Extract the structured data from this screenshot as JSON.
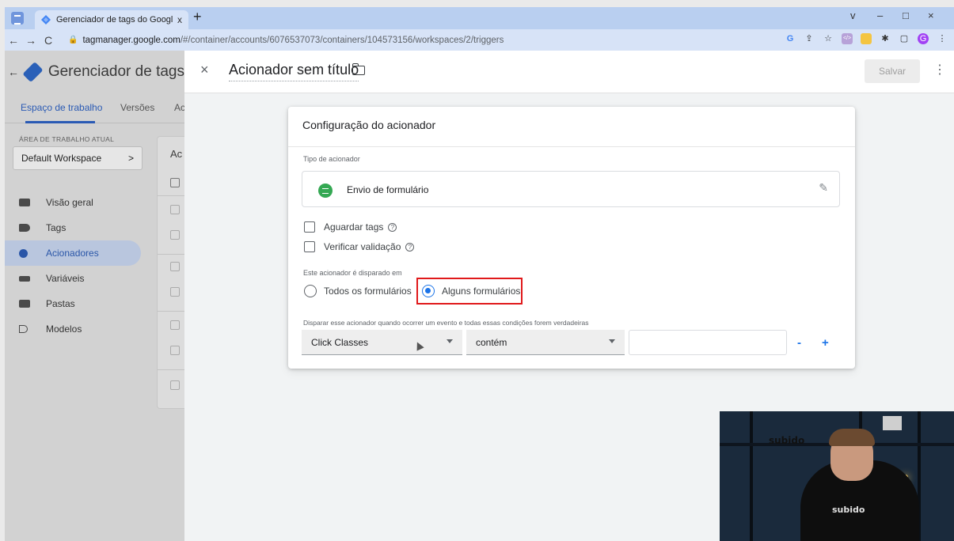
{
  "browser": {
    "tab_title": "Gerenciador de tags do Google",
    "tab_close": "x",
    "new_tab": "+",
    "url_host": "tagmanager.google.com",
    "url_path": "/#/container/accounts/6076537073/containers/104573156/workspaces/2/triggers",
    "window_controls": [
      "v",
      "–",
      "□",
      "×"
    ]
  },
  "gtm": {
    "back": "←",
    "title": "Gerenciador de tags",
    "tabs": [
      {
        "label": "Espaço de trabalho"
      },
      {
        "label": "Versões"
      },
      {
        "label": "Ac"
      }
    ],
    "workspace_label": "ÁREA DE TRABALHO ATUAL",
    "workspace_name": "Default Workspace",
    "workspace_chevron": ">",
    "list_header": "Ac",
    "nav": [
      {
        "label": "Visão geral",
        "icon": "briefcase-icon"
      },
      {
        "label": "Tags",
        "icon": "tag-icon"
      },
      {
        "label": "Acionadores",
        "icon": "trigger-icon"
      },
      {
        "label": "Variáveis",
        "icon": "variables-icon"
      },
      {
        "label": "Pastas",
        "icon": "folder-icon"
      },
      {
        "label": "Modelos",
        "icon": "template-icon"
      }
    ]
  },
  "editor": {
    "close": "×",
    "title": "Acionador sem título",
    "save_label": "Salvar",
    "more": "⋮",
    "card_title": "Configuração do acionador",
    "type_label": "Tipo de acionador",
    "type_value": "Envio de formulário",
    "wait_tags": "Aguardar tags",
    "check_validation": "Verificar validação",
    "fires_on_label": "Este acionador é disparado em",
    "radio_all": "Todos os formulários",
    "radio_some": "Alguns formulários",
    "radio_selected": "Alguns formulários",
    "condition_label": "Disparar esse acionador quando ocorrer um evento e todas essas condições forem verdadeiras",
    "condition_variable": "Click Classes",
    "condition_operator": "contém",
    "condition_value": "",
    "minus": "-",
    "plus": "+",
    "help": "?"
  },
  "colors": {
    "accent": "#1a73e8",
    "highlight_box": "#e0191b",
    "form_icon": "#34a853"
  },
  "webcam": {
    "shelf_logo": "subido",
    "shirt_logo": "subido"
  }
}
